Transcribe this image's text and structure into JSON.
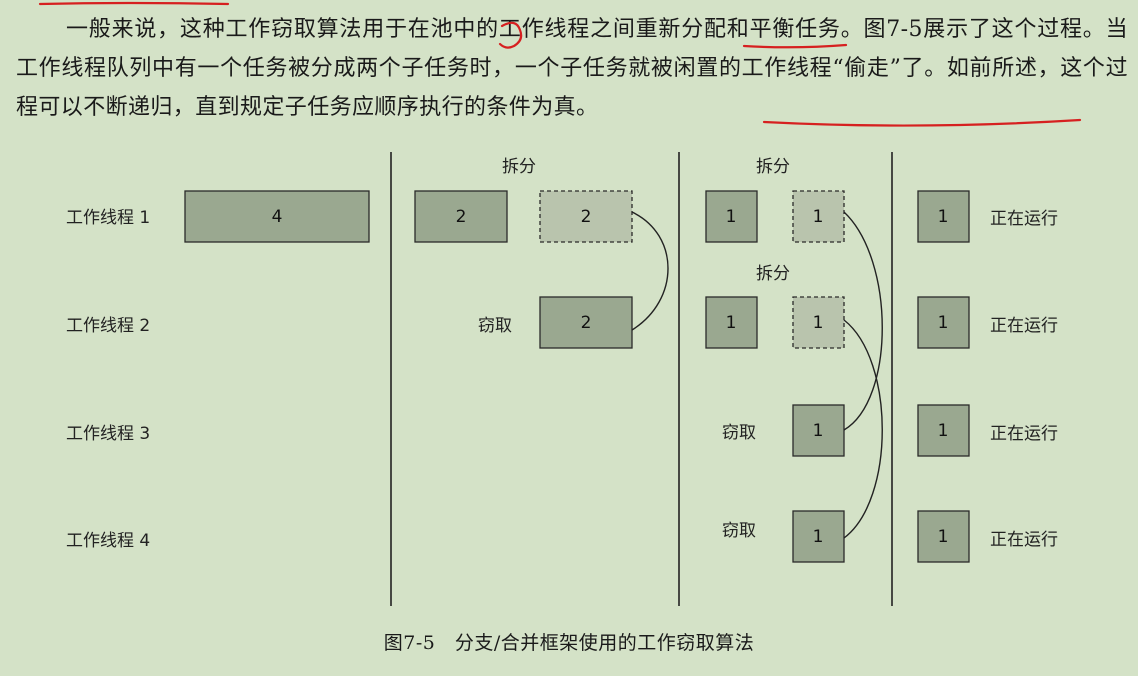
{
  "paragraph": {
    "text": "一般来说，这种工作窃取算法用于在池中的工作线程之间重新分配和平衡任务。图7-5展示了这个过程。当工作线程队列中有一个任务被分成两个子任务时，一个子任务就被闲置的工作线程“偷走”了。如前所述，这个过程可以不断递归，直到规定子任务应顺序执行的条件为真。"
  },
  "diagram": {
    "threads": [
      "工作线程 1",
      "工作线程 2",
      "工作线程 3",
      "工作线程 4"
    ],
    "split_label": "拆分",
    "steal_label": "窃取",
    "running_label": "正在运行",
    "boxes": {
      "t1_stage1": "4",
      "t1_stage2_kept": "2",
      "t1_stage2_split": "2",
      "t2_stage2_stolen": "2",
      "t1_stage3_kept": "1",
      "t1_stage3_split": "1",
      "t2_stage3_kept": "1",
      "t2_stage3_split": "1",
      "t3_stage3_stolen": "1",
      "t4_stage3_stolen": "1",
      "t1_final": "1",
      "t2_final": "1",
      "t3_final": "1",
      "t4_final": "1"
    },
    "colors": {
      "box_dark": "#9aa890",
      "box_light": "#b9c4ad",
      "stroke": "#2a2a2a",
      "annotation_red": "#d62020"
    }
  },
  "caption": "图7-5　分支/合并框架使用的工作窃取算法"
}
